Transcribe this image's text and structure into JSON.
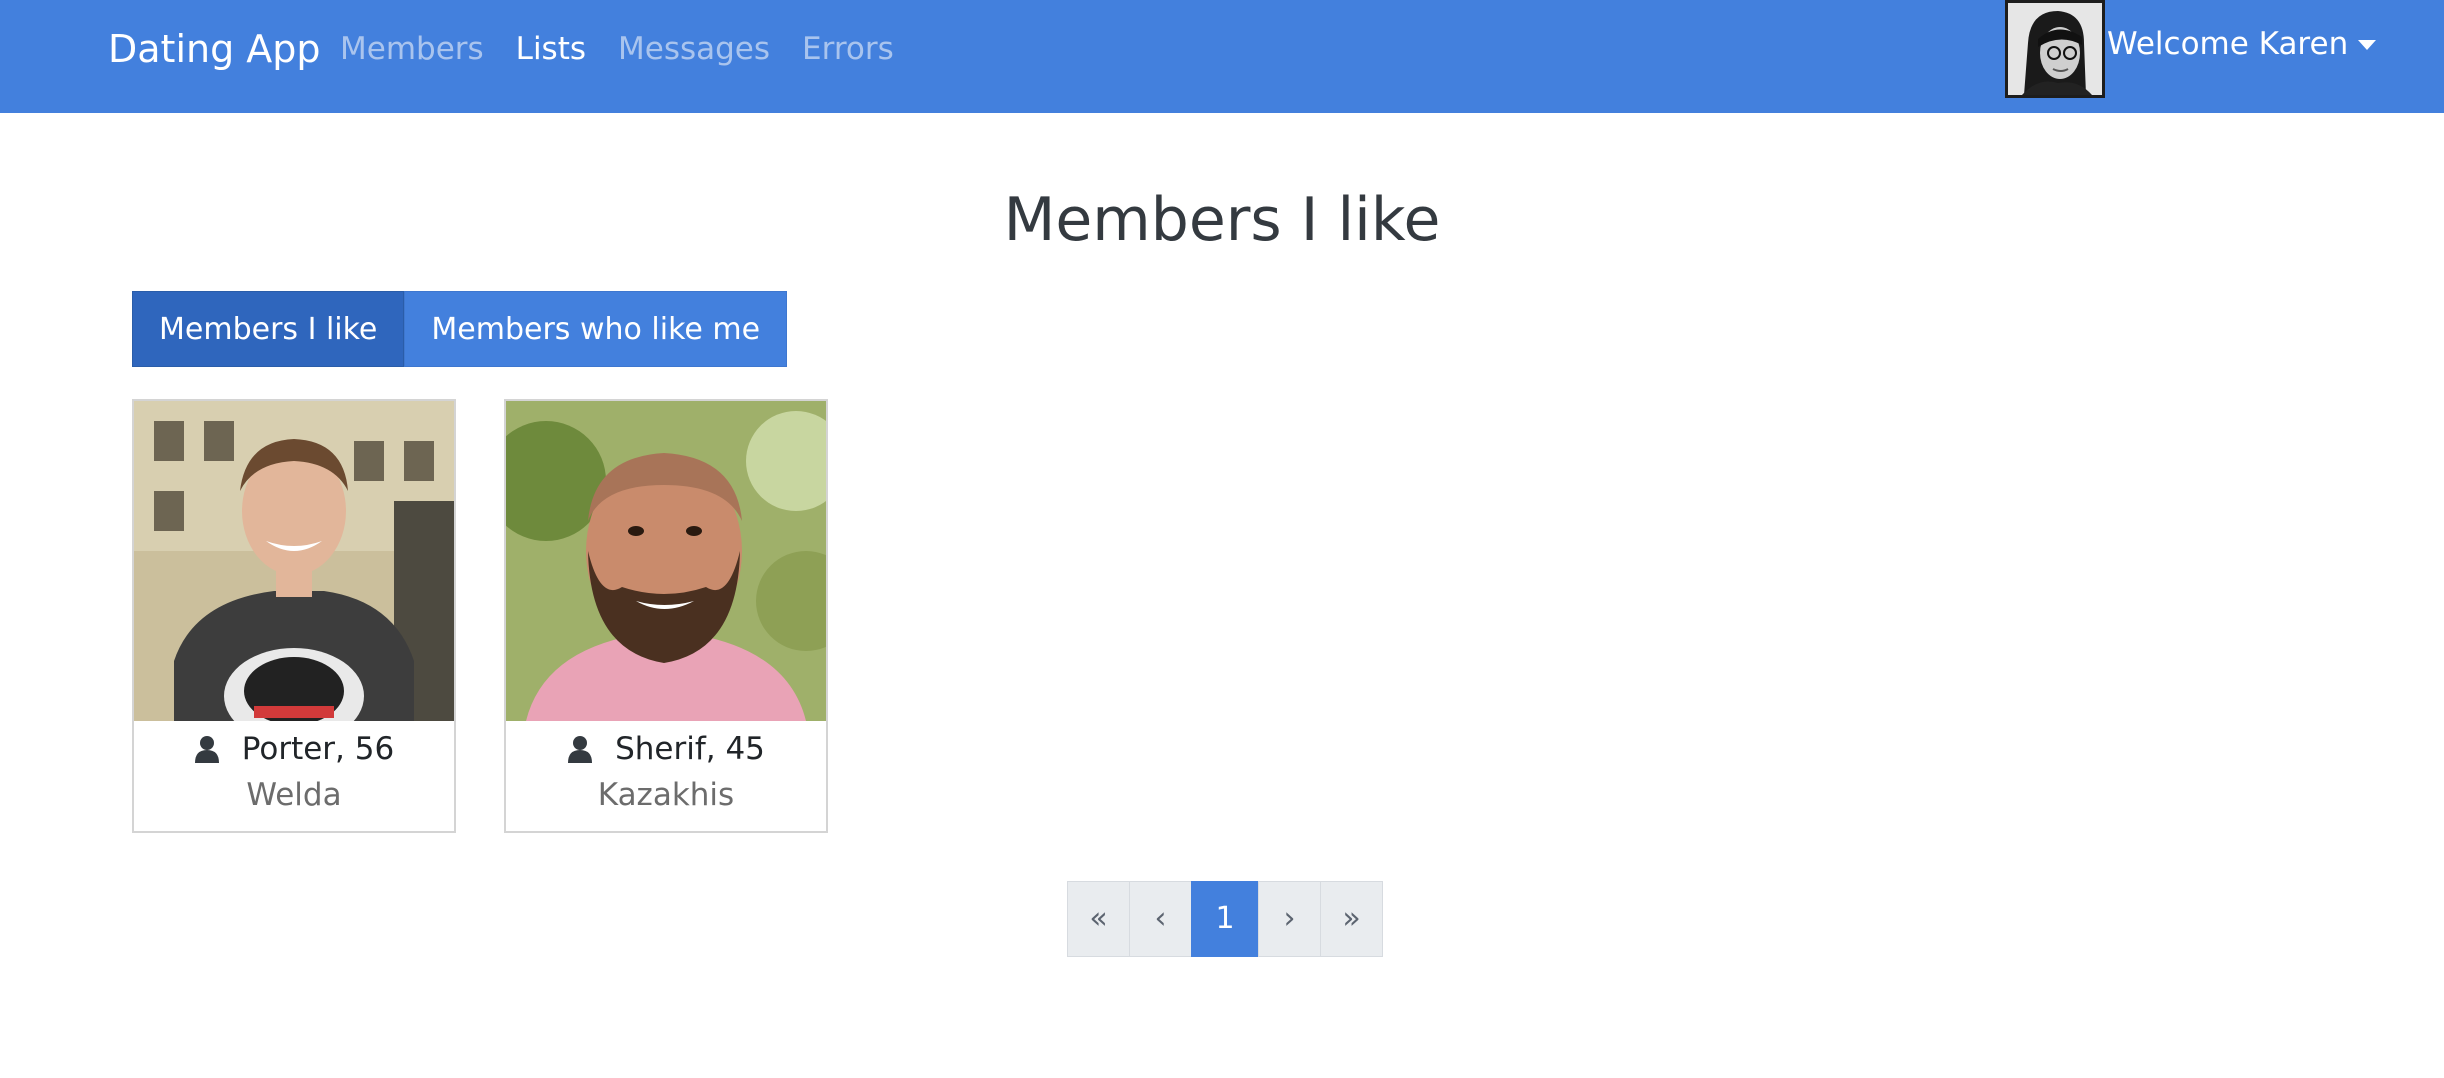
{
  "navbar": {
    "brand": "Dating App",
    "links": [
      {
        "label": "Members",
        "active": false
      },
      {
        "label": "Lists",
        "active": true
      },
      {
        "label": "Messages",
        "active": false
      },
      {
        "label": "Errors",
        "active": false
      }
    ],
    "welcome": "Welcome Karen",
    "colors": {
      "background": "#4380dd",
      "active_link": "#ffffff",
      "inactive_link": "#a9c4ee"
    }
  },
  "page": {
    "title": "Members I like"
  },
  "toggle": {
    "buttons": [
      {
        "label": "Members I like",
        "active": true
      },
      {
        "label": "Members who like me",
        "active": false
      }
    ]
  },
  "members": [
    {
      "name_age": "Porter, 56",
      "city": "Welda",
      "icon": "user-icon"
    },
    {
      "name_age": "Sherif, 45",
      "city": "Kazakhis",
      "icon": "user-icon"
    }
  ],
  "pagination": {
    "first": "«",
    "prev": "‹",
    "current": "1",
    "next": "›",
    "last": "»"
  }
}
